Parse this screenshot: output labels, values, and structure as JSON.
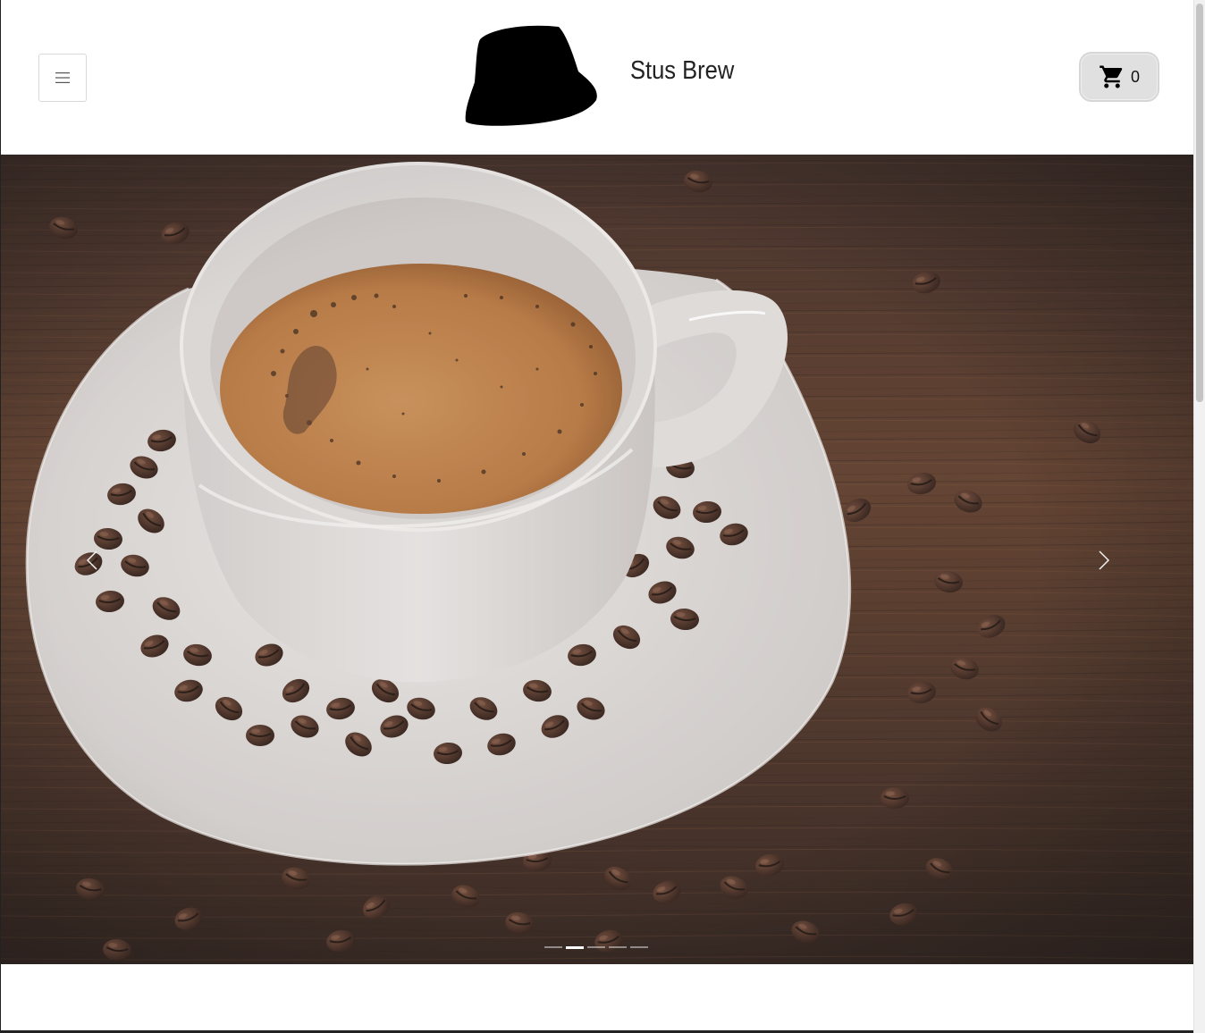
{
  "header": {
    "menu_icon": "hamburger-menu-icon",
    "logo_icon": "bucket-hat-logo",
    "brand_name": "Stus Brew",
    "cart": {
      "icon": "shopping-cart-icon",
      "count": "0"
    }
  },
  "hero": {
    "image": "coffee-cup-with-beans-on-wooden-table",
    "prev_icon": "chevron-left-icon",
    "next_icon": "chevron-right-icon",
    "slide_count": 5,
    "active_slide": 2
  },
  "colors": {
    "cart_background": "#e0e0e0",
    "text": "#222222",
    "wood": "#4e3124",
    "cup": "#d8d5d3",
    "coffee": "#b7773e"
  }
}
